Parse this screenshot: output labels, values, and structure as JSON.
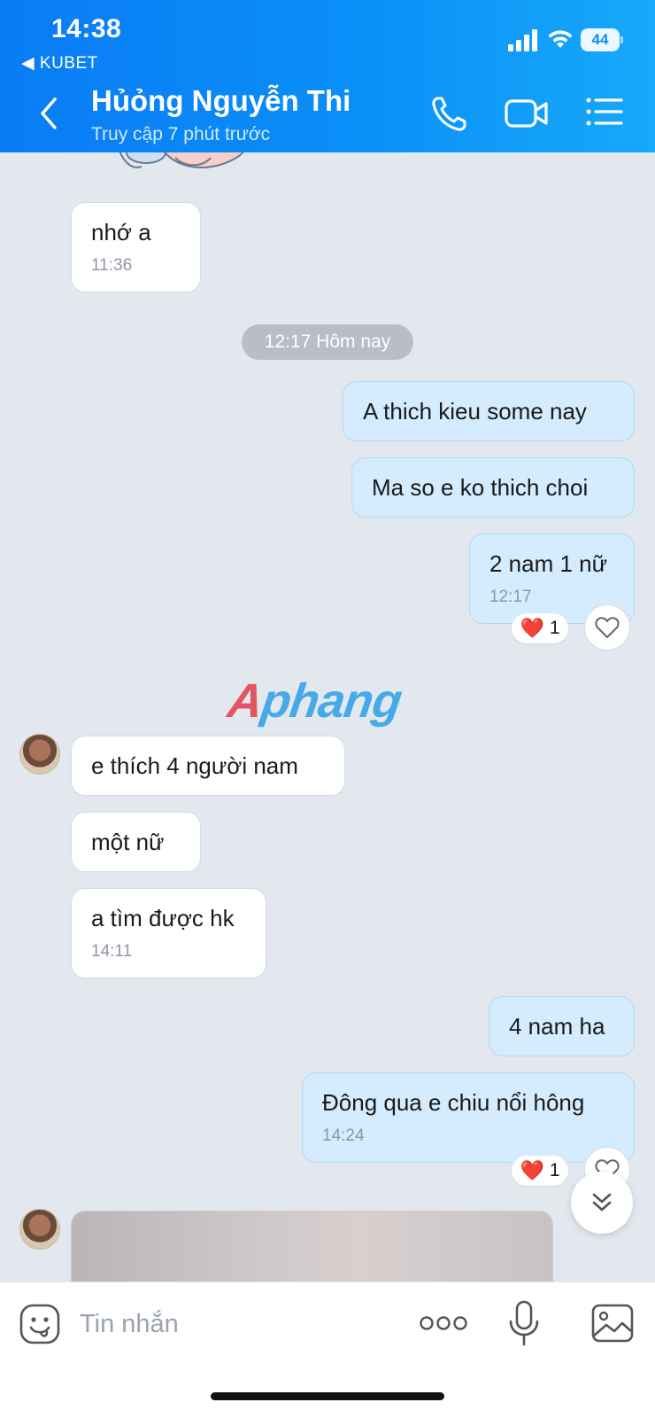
{
  "status_bar": {
    "time": "14:38",
    "back_app": "◀ KUBET",
    "battery": "44"
  },
  "header": {
    "contact_name": "Hủỏng Nguyễn Thi",
    "contact_status": "Truy cập 7 phút trước"
  },
  "messages": [
    {
      "id": "m1",
      "side": "in",
      "text": "nhớ a",
      "time": "11:36"
    },
    {
      "id": "sep1",
      "type": "date",
      "text": "12:17 Hôm nay"
    },
    {
      "id": "m2",
      "side": "out",
      "text": "A thich kieu some nay"
    },
    {
      "id": "m3",
      "side": "out",
      "text": "Ma so e ko thich choi"
    },
    {
      "id": "m4",
      "side": "out",
      "text": "2 nam 1 nữ",
      "time": "12:17",
      "reaction": {
        "emoji": "❤️",
        "count": "1"
      }
    },
    {
      "id": "m5",
      "side": "in",
      "text": "e thích 4 người nam"
    },
    {
      "id": "m6",
      "side": "in",
      "text": "một nữ"
    },
    {
      "id": "m7",
      "side": "in",
      "text": "a tìm được hk",
      "time": "14:11"
    },
    {
      "id": "m8",
      "side": "out",
      "text": "4 nam ha"
    },
    {
      "id": "m9",
      "side": "out",
      "text": "Đông qua e chiu nổi hông",
      "time": "14:24",
      "reaction": {
        "emoji": "❤️",
        "count": "1"
      }
    }
  ],
  "watermark": {
    "first_letter": "A",
    "rest": "phang"
  },
  "input_bar": {
    "placeholder": "Tin nhắn"
  },
  "colors": {
    "header_gradient_start": "#0a7cf5",
    "header_gradient_end": "#17a9fa",
    "outgoing_bubble": "#d4ecfd",
    "incoming_bubble": "#ffffff",
    "chat_background": "#e3e8ef"
  }
}
